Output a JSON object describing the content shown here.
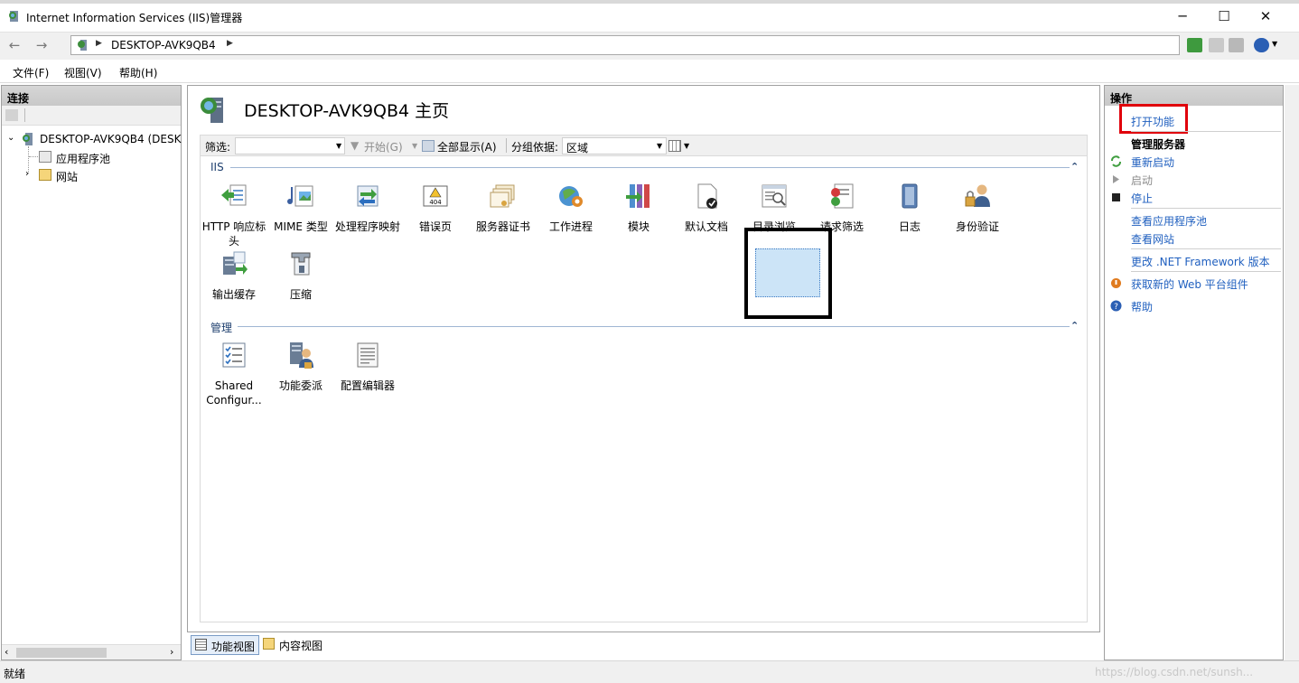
{
  "window": {
    "title": "Internet Information Services (IIS)管理器",
    "minimize": "─",
    "maximize": "☐",
    "close": "✕"
  },
  "address": {
    "path": "DESKTOP-AVK9QB4",
    "back": "←",
    "forward": "→"
  },
  "menu": [
    "文件(F)",
    "视图(V)",
    "帮助(H)"
  ],
  "connections": {
    "header": "连接",
    "tree": {
      "root": "DESKTOP-AVK9QB4 (DESK",
      "children": [
        "应用程序池",
        "网站"
      ]
    }
  },
  "center": {
    "title": "DESKTOP-AVK9QB4 主页",
    "filter": {
      "label": "筛选:",
      "start": "开始(G)",
      "show_all": "全部显示(A)",
      "group_label": "分组依据:",
      "group_value": "区域"
    },
    "sections": [
      {
        "name": "IIS",
        "features": [
          {
            "label": "HTTP 响应标头",
            "icon": "http-response-headers-icon"
          },
          {
            "label": "MIME 类型",
            "icon": "mime-types-icon"
          },
          {
            "label": "处理程序映射",
            "icon": "handler-mappings-icon"
          },
          {
            "label": "错误页",
            "icon": "error-pages-icon"
          },
          {
            "label": "服务器证书",
            "icon": "server-certificates-icon"
          },
          {
            "label": "工作进程",
            "icon": "worker-processes-icon"
          },
          {
            "label": "模块",
            "icon": "modules-icon"
          },
          {
            "label": "默认文档",
            "icon": "default-document-icon"
          },
          {
            "label": "目录浏览",
            "icon": "directory-browsing-icon"
          },
          {
            "label": "请求筛选",
            "icon": "request-filtering-icon"
          },
          {
            "label": "日志",
            "icon": "logging-icon"
          },
          {
            "label": "身份验证",
            "icon": "authentication-icon"
          },
          {
            "label": "输出缓存",
            "icon": "output-caching-icon"
          },
          {
            "label": "压缩",
            "icon": "compression-icon"
          }
        ]
      },
      {
        "name": "管理",
        "features": [
          {
            "label": "Shared Configur...",
            "icon": "shared-configuration-icon"
          },
          {
            "label": "功能委派",
            "icon": "feature-delegation-icon"
          },
          {
            "label": "配置编辑器",
            "icon": "configuration-editor-icon"
          }
        ]
      }
    ],
    "tabs": [
      "功能视图",
      "内容视图"
    ]
  },
  "actions": {
    "header": "操作",
    "open_feature": "打开功能",
    "manage_server": "管理服务器",
    "restart": "重新启动",
    "start": "启动",
    "stop": "停止",
    "view_app_pools": "查看应用程序池",
    "view_sites": "查看网站",
    "change_net": "更改 .NET Framework 版本",
    "get_web_platform": "获取新的 Web 平台组件",
    "help": "帮助"
  },
  "status": {
    "text": "就绪",
    "watermark": "https://blog.csdn.net/sunsh..."
  },
  "colors": {
    "link": "#1f5fbf",
    "highlight_red": "#e0000b",
    "highlight_black": "#000000",
    "selection": "#cce4f7"
  }
}
